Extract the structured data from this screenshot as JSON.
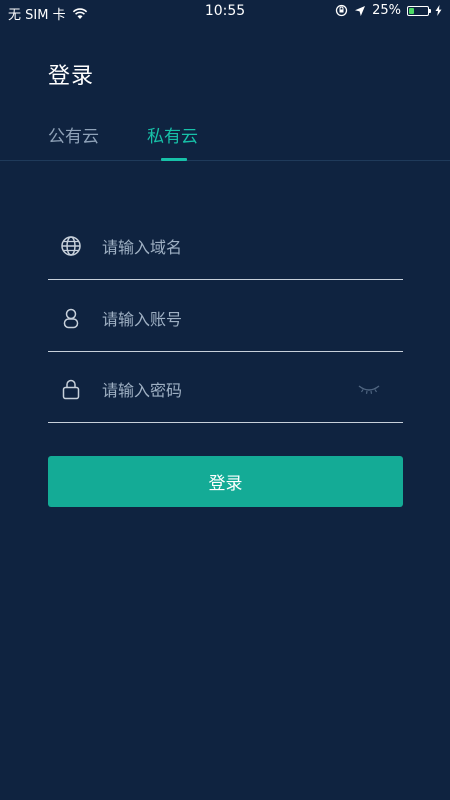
{
  "status_bar": {
    "carrier": "无 SIM 卡",
    "time": "10:55",
    "battery_percent": "25%",
    "battery_level": 0.25,
    "battery_color": "#4cd964"
  },
  "page": {
    "title": "登录"
  },
  "tabs": [
    {
      "label": "公有云",
      "active": false
    },
    {
      "label": "私有云",
      "active": true
    }
  ],
  "form": {
    "domain": {
      "placeholder": "请输入域名",
      "value": "",
      "icon": "globe-icon"
    },
    "account": {
      "placeholder": "请输入账号",
      "value": "",
      "icon": "user-icon"
    },
    "password": {
      "placeholder": "请输入密码",
      "value": "",
      "icon": "lock-icon",
      "toggle_icon": "eye-closed-icon"
    },
    "submit_label": "登录"
  },
  "colors": {
    "background": "#0f2340",
    "accent": "#17c1a8",
    "button": "#14ab96",
    "inactive_tab": "#8fa2b8",
    "placeholder": "#9fb0c3"
  }
}
